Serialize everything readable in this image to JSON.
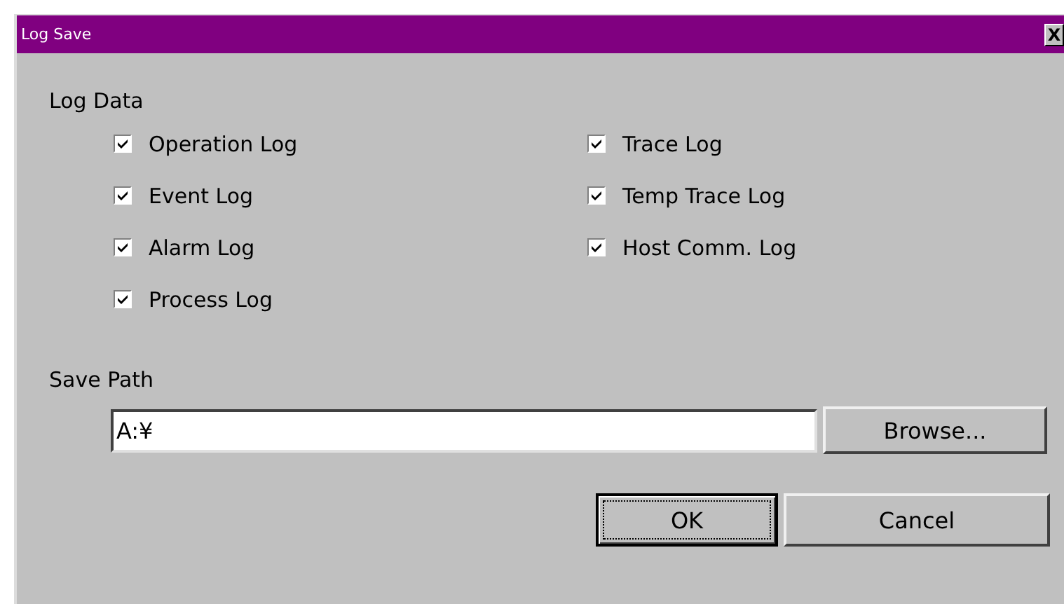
{
  "window": {
    "title": "Log Save",
    "close": "X"
  },
  "log_data": {
    "label": "Log Data",
    "columns": [
      [
        {
          "label": "Operation Log",
          "checked": true
        },
        {
          "label": "Event Log",
          "checked": true
        },
        {
          "label": "Alarm Log",
          "checked": true
        },
        {
          "label": "Process Log",
          "checked": true
        }
      ],
      [
        {
          "label": "Trace Log",
          "checked": true
        },
        {
          "label": "Temp Trace Log",
          "checked": true
        },
        {
          "label": "Host Comm. Log",
          "checked": true
        }
      ]
    ]
  },
  "save_path": {
    "label": "Save Path",
    "value": "A:¥",
    "browse": "Browse..."
  },
  "buttons": [
    {
      "label": "OK",
      "default": true
    },
    {
      "label": "Cancel",
      "default": false
    }
  ]
}
